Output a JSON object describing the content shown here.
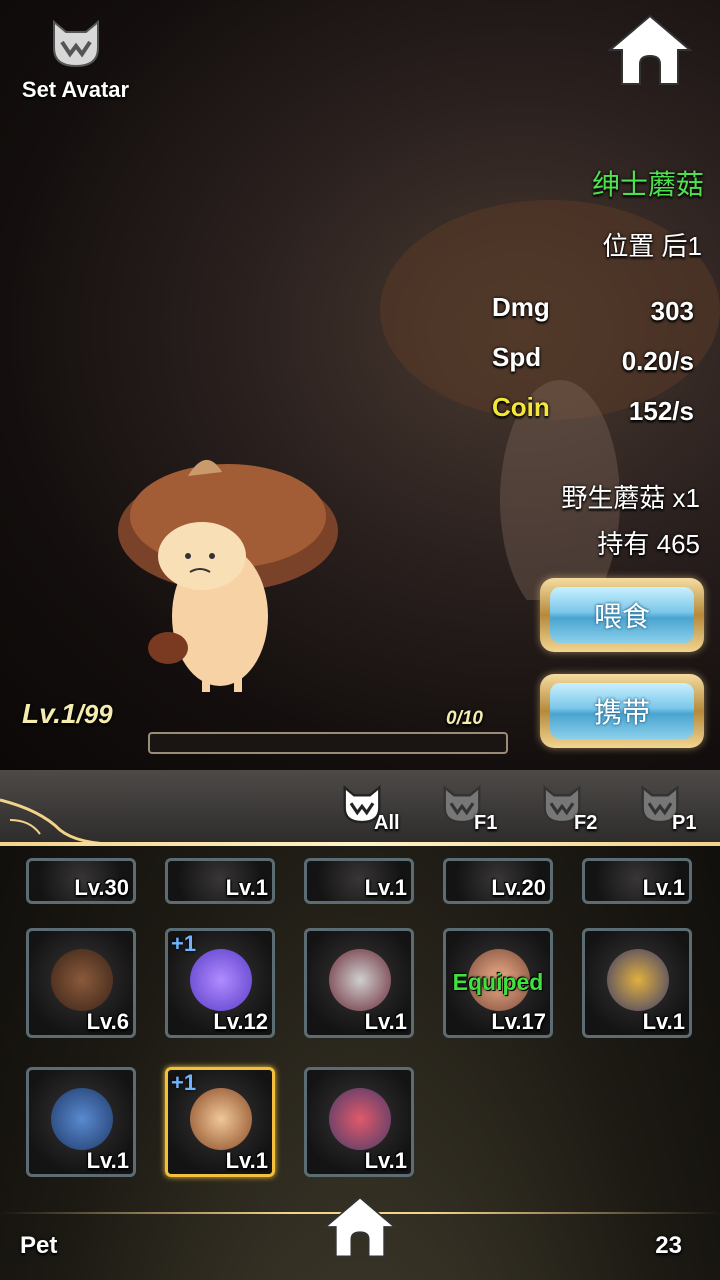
{
  "header": {
    "set_avatar_label": "Set Avatar"
  },
  "pet": {
    "name": "绅士蘑菇",
    "position": "位置 后1",
    "stats": [
      {
        "label": "Dmg",
        "value": "303",
        "label_color": "#ffffff"
      },
      {
        "label": "Spd",
        "value": "0.20/s",
        "label_color": "#ffffff"
      },
      {
        "label": "Coin",
        "value": "152/s",
        "label_color": "#f5e63a"
      }
    ],
    "food_required": "野生蘑菇 x1",
    "owned": "持有 465",
    "feed_button": "喂食",
    "carry_button": "携带",
    "level": "Lv.1",
    "max_level": "/99",
    "xp": "0/10",
    "xp_fraction": 0.0
  },
  "tabs": [
    {
      "label": "All",
      "active": true
    },
    {
      "label": "F1",
      "active": false
    },
    {
      "label": "F2",
      "active": false
    },
    {
      "label": "P1",
      "active": false
    }
  ],
  "grid": {
    "row_partial": [
      "Lv.30",
      "Lv.1",
      "Lv.1",
      "Lv.20",
      "Lv.1"
    ],
    "rows": [
      [
        {
          "level": "Lv.6",
          "plus": "",
          "equipped": ""
        },
        {
          "level": "Lv.12",
          "plus": "+1",
          "equipped": ""
        },
        {
          "level": "Lv.1",
          "plus": "",
          "equipped": ""
        },
        {
          "level": "Lv.17",
          "plus": "",
          "equipped": "Equiped"
        },
        {
          "level": "Lv.1",
          "plus": "",
          "equipped": ""
        }
      ],
      [
        {
          "level": "Lv.1",
          "plus": "",
          "equipped": ""
        },
        {
          "level": "Lv.1",
          "plus": "+1",
          "equipped": "",
          "selected": true
        },
        {
          "level": "Lv.1",
          "plus": "",
          "equipped": ""
        }
      ]
    ]
  },
  "footer": {
    "title": "Pet",
    "count": "23"
  },
  "colors": {
    "name_green": "#4fe04f",
    "coin_yellow": "#f5e63a",
    "selected_border": "#f2c03c",
    "accent_gold": "#f3d38a"
  }
}
